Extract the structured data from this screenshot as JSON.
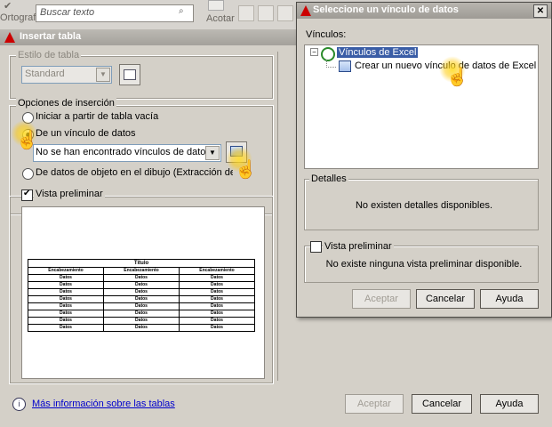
{
  "ribbon": {
    "spell_label": "Ortografía",
    "search_placeholder": "Buscar texto",
    "scale_label": "Acotar"
  },
  "main_dialog": {
    "title": "Insertar tabla",
    "style_group": "Estilo de tabla",
    "style_value": "Standard",
    "insert_group": "Opciones de inserción",
    "opt_empty": "Iniciar a partir de tabla vacía",
    "opt_link": "De un vínculo de datos",
    "link_combo": "No se han encontrado vínculos de datos",
    "opt_object": "De datos de objeto en el dibujo (Extracción de datos)",
    "preview_label": "Vista preliminar",
    "preview_table": {
      "title": "Título",
      "header": [
        "Encabezamiento",
        "Encabezamiento",
        "Encabezamiento"
      ],
      "cell": "Datos",
      "rows": 8
    },
    "more_info": "Más información sobre las tablas",
    "accept": "Aceptar",
    "cancel": "Cancelar",
    "help": "Ayuda"
  },
  "link_dialog": {
    "title": "Seleccione un vínculo de datos",
    "links_label": "Vínculos:",
    "tree_root": "Vínculos de Excel",
    "tree_child": "Crear un nuevo vínculo de datos de Excel",
    "details_label": "Detalles",
    "details_text": "No existen detalles disponibles.",
    "preview_label": "Vista preliminar",
    "preview_text": "No existe ninguna vista preliminar disponible.",
    "accept": "Aceptar",
    "cancel": "Cancelar",
    "help": "Ayuda",
    "close": "✕"
  },
  "colors": {
    "dialog_bg": "#d4d0c8",
    "selection": "#3a5da6",
    "link": "#0000cc",
    "highlight": "#ffd21e"
  }
}
